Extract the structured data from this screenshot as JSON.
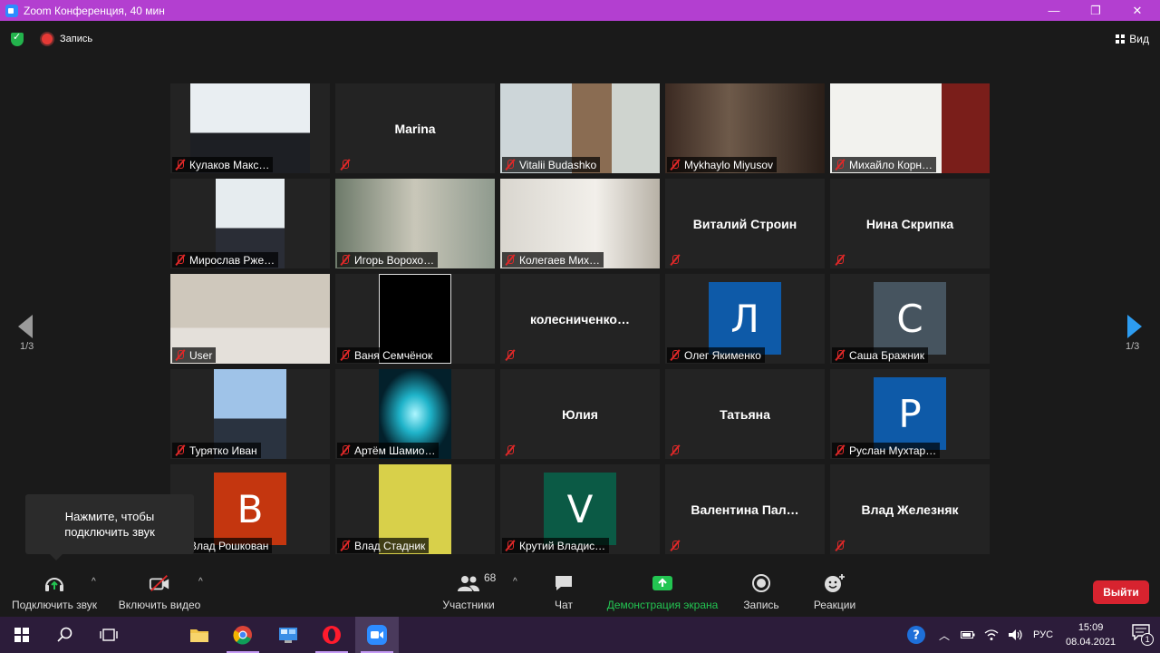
{
  "window": {
    "title": "Zoom Конференция, 40 мин",
    "minimize": "—",
    "restore": "❐",
    "close": "✕"
  },
  "meeting_bar": {
    "record_label": "Запись",
    "view_label": "Вид"
  },
  "gallery": {
    "page_label": "1/3",
    "tiles": [
      {
        "name": "Кулаков Макс…",
        "type": "video"
      },
      {
        "name": "Marina",
        "type": "name"
      },
      {
        "name": "Vitalii Budashko",
        "type": "video"
      },
      {
        "name": "Mykhaylo Miyusov",
        "type": "video",
        "active": true
      },
      {
        "name": "Михайло Корн…",
        "type": "video"
      },
      {
        "name": "Мирослав Рже…",
        "type": "video"
      },
      {
        "name": "Игорь Ворохо…",
        "type": "video"
      },
      {
        "name": "Колегаев Мих…",
        "type": "video"
      },
      {
        "name": "Виталий Строин",
        "type": "name"
      },
      {
        "name": "Нина Скрипка",
        "type": "name"
      },
      {
        "name": "User",
        "type": "video"
      },
      {
        "name": "Ваня Семчёнок",
        "type": "video"
      },
      {
        "name": "колесниченко…",
        "type": "name"
      },
      {
        "name": "Олег Якименко",
        "type": "avatar",
        "letter": "Л",
        "color": "#0e5aa8"
      },
      {
        "name": "Саша Бражник",
        "type": "avatar",
        "letter": "С",
        "color": "#46545f"
      },
      {
        "name": "Турятко Иван",
        "type": "video"
      },
      {
        "name": "Артём Шамио…",
        "type": "video"
      },
      {
        "name": "Юлия",
        "type": "name"
      },
      {
        "name": "Татьяна",
        "type": "name"
      },
      {
        "name": "Руслан Мухтар…",
        "type": "avatar",
        "letter": "Р",
        "color": "#0e5aa8"
      },
      {
        "name": "Влад Рошкован",
        "type": "avatar",
        "letter": "В",
        "color": "#c4360f"
      },
      {
        "name": "Влад Стадник",
        "type": "video"
      },
      {
        "name": "Крутий Владис…",
        "type": "avatar",
        "letter": "V",
        "color": "#0b5a45"
      },
      {
        "name": "Валентина  Пал…",
        "type": "name"
      },
      {
        "name": "Влад Железняк",
        "type": "name"
      }
    ]
  },
  "tooltip": {
    "line1": "Нажмите, чтобы",
    "line2": "подключить звук"
  },
  "toolbar": {
    "audio": "Подключить звук",
    "video": "Включить видео",
    "participants": "Участники",
    "participants_count": "68",
    "chat": "Чат",
    "share": "Демонстрация экрана",
    "record": "Запись",
    "reactions": "Реакции",
    "leave": "Выйти",
    "share_color": "#23c552"
  },
  "taskbar": {
    "lang": "РУС",
    "time": "15:09",
    "date": "08.04.2021",
    "notifications": "1"
  }
}
